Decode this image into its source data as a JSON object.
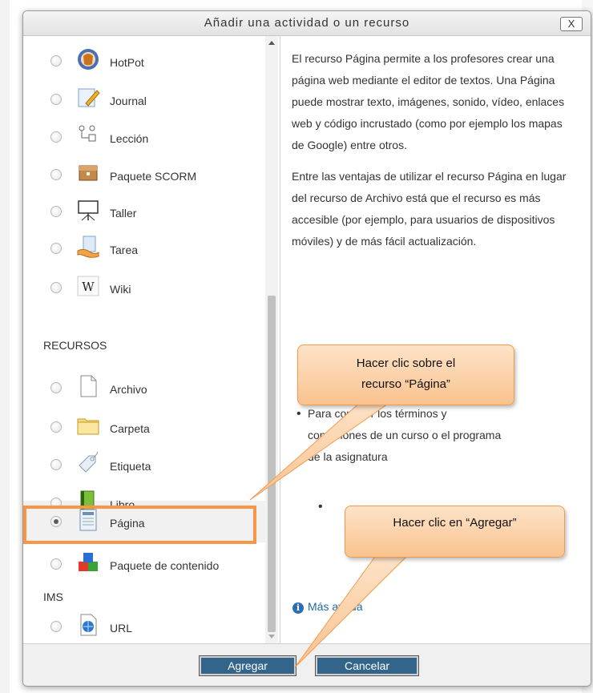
{
  "dialog": {
    "title": "Añadir una actividad o un recurso",
    "close_label": "X"
  },
  "list": {
    "items_top": [
      {
        "label": "HotPot",
        "icon": "hotpot-icon"
      },
      {
        "label": "Journal",
        "icon": "journal-icon"
      },
      {
        "label": "Lección",
        "icon": "lesson-icon"
      },
      {
        "label": "Paquete SCORM",
        "icon": "scorm-package-icon"
      },
      {
        "label": "Taller",
        "icon": "workshop-icon"
      },
      {
        "label": "Tarea",
        "icon": "assignment-icon"
      },
      {
        "label": "Wiki",
        "icon": "wiki-icon"
      }
    ],
    "section_recursos": "RECURSOS",
    "items_recursos": [
      {
        "label": "Archivo",
        "icon": "file-icon"
      },
      {
        "label": "Carpeta",
        "icon": "folder-icon"
      },
      {
        "label": "Etiqueta",
        "icon": "label-icon"
      },
      {
        "label": "Libro",
        "icon": "book-icon"
      },
      {
        "label": "Página",
        "icon": "page-icon"
      },
      {
        "label": "Paquete de contenido",
        "icon": "content-package-icon"
      }
    ],
    "section_ims": "IMS",
    "items_ims": [
      {
        "label": "URL",
        "icon": "url-icon"
      }
    ],
    "selected": "Página"
  },
  "description": {
    "p1": "El recurso Página permite a los profesores crear una página web mediante el editor de textos. Una Página puede mostrar texto, imágenes, sonido, vídeo, enlaces web y código incrustado (como por ejemplo los mapas de Google) entre otros.",
    "p2": "Entre las ventajas de utilizar el recurso Página en lugar del recurso de Archivo está que el recurso es más accesible (por ejemplo, para usuarios de dispositivos móviles) y de más fácil actualización.",
    "bullet1_line1": "Para conocer los términos y",
    "bullet1_line2": "condiciones de un curso o el programa",
    "bullet1_line3": "de la asignatura",
    "more_help": "Más ayuda"
  },
  "buttons": {
    "add": "Agregar",
    "cancel": "Cancelar"
  },
  "callouts": {
    "page": "Hacer clic sobre el recurso “Página”",
    "add": "Hacer clic en “Agregar”"
  },
  "colors": {
    "highlight": "#f79646",
    "callout_fill": "#fbd0a6",
    "button": "#33658a"
  }
}
